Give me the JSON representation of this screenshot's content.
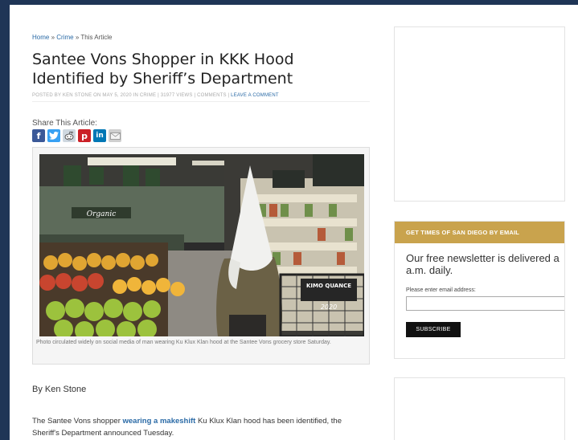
{
  "breadcrumb": {
    "home": "Home",
    "sep1": " » ",
    "crime": "Crime",
    "sep2": " » ",
    "current": "This Article"
  },
  "article": {
    "title": "Santee Vons Shopper in KKK Hood Identified by Sheriff’s Department",
    "meta": {
      "prefix": "Posted by Ken Stone on May 5, 2020 in Crime | 31977 Views | Comments | ",
      "leave_comment": "Leave a Comment"
    },
    "share_label": "Share This Article:",
    "share_icons": [
      "facebook-icon",
      "twitter-icon",
      "reddit-icon",
      "pinterest-icon",
      "linkedin-icon",
      "email-icon"
    ],
    "photo": {
      "sign_organic": "Organic",
      "sign_kimo": "KIMO QUANCE",
      "sign_year": "2020"
    },
    "caption": "Photo circulated widely on social media of man wearing Ku Klux Klan hood at the Santee Vons grocery store Saturday.",
    "byline": "By Ken Stone",
    "body": {
      "part1": "The Santee Vons shopper ",
      "link": "wearing a makeshift",
      "part2": " Ku Klux Klan hood has been identified, the Sheriff's Department announced Tuesday."
    }
  },
  "sidebar": {
    "newsletter": {
      "header": "Get Times of San Diego by Email",
      "text_line1": "Our free newsletter is delivered a",
      "text_line2": "a.m. daily.",
      "email_label": "Please enter email address:",
      "email_value": "",
      "subscribe_label": "Subscribe"
    }
  },
  "colors": {
    "frame": "#1f3556",
    "link": "#2a6aa6",
    "widget_header": "#c9a34d"
  }
}
